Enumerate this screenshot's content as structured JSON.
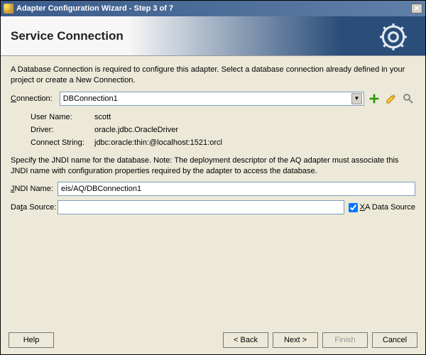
{
  "window": {
    "title": "Adapter Configuration Wizard - Step 3 of 7"
  },
  "header": {
    "title": "Service Connection"
  },
  "intro": "A Database Connection is required to configure this adapter. Select a database connection already defined in your project or create a New Connection.",
  "connection": {
    "label_pre": "C",
    "label_post": "onnection:",
    "value": "DBConnection1"
  },
  "details": {
    "username_label": "User Name:",
    "username": "scott",
    "driver_label": "Driver:",
    "driver": "oracle.jdbc.OracleDriver",
    "connect_label": "Connect String:",
    "connect": "jdbc:oracle:thin:@localhost:1521:orcl"
  },
  "jndi_text": "Specify the JNDI name for the database.  Note: The deployment descriptor of the AQ adapter must associate this JNDI name with configuration properties required by the adapter to access the database.",
  "jndi": {
    "label_pre": "J",
    "label_post": "NDI Name:",
    "value": "eis/AQ/DBConnection1"
  },
  "datasource": {
    "label_pre": "Da",
    "label_u": "t",
    "label_post": "a Source:",
    "value": ""
  },
  "xa": {
    "label_pre": "X",
    "label_post": "A Data Source",
    "checked": true
  },
  "buttons": {
    "help": "Help",
    "back": "< Back",
    "next": "Next >",
    "finish": "Finish",
    "cancel": "Cancel"
  }
}
